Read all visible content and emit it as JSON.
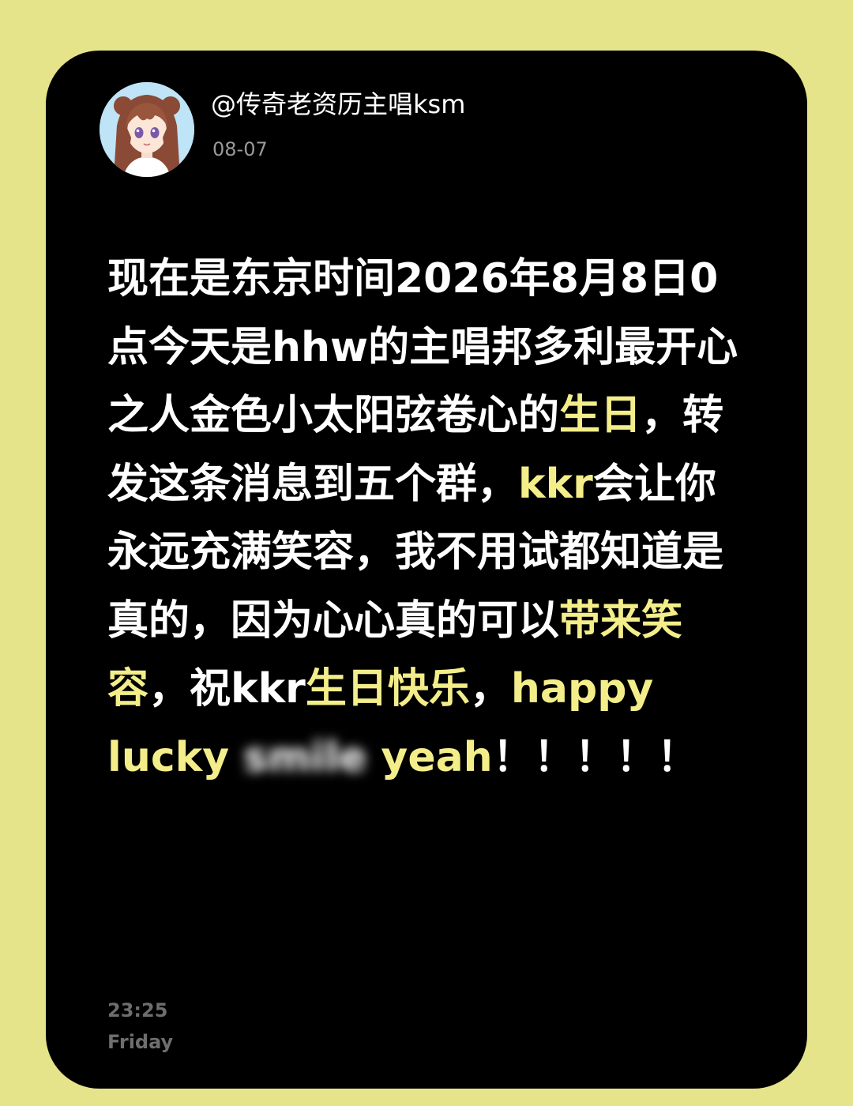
{
  "background_color": "#e6e48a",
  "card_color": "#000000",
  "highlight_color": "#f4ee8a",
  "avatar": {
    "icon": "anime-girl-avatar-icon"
  },
  "header": {
    "username": "@传奇老资历主唱ksm",
    "date": "08-07"
  },
  "message": {
    "seg1": "现在是东京时间2026年8月8日0点今天是hhw的主唱邦多利最开心之人金色小太阳弦卷心的",
    "hl1": "生日",
    "seg2": "，转发这条消息到五个群，",
    "hl2": "kkr",
    "seg3": "会让你永远充满笑容，我不用试都知道是真的，因为心心真的可以",
    "hl3": "带来笑容",
    "seg4": "，祝kkr",
    "hl4": "生日快乐",
    "seg5": "，",
    "hl5": "happy lucky ",
    "blurred": "smile",
    "hl6": " yeah",
    "seg6": "！！！！！"
  },
  "footer": {
    "time": "23:25",
    "weekday": "Friday"
  }
}
